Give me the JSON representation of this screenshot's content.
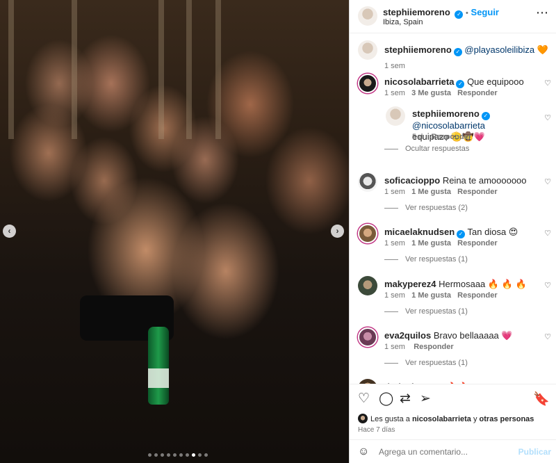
{
  "photo": {
    "description_icon": "party-photo",
    "prev_icon": "chevron-left-icon",
    "next_icon": "chevron-right-icon",
    "carousel_index": 8,
    "carousel_count": 10
  },
  "header": {
    "username": "stephiiemoreno",
    "separator": "•",
    "follow": "Seguir",
    "location": "Ibiza, Spain",
    "more": "⋯"
  },
  "caption": {
    "username": "stephiiemoreno",
    "mention": "@playasoleilibiza",
    "emoji": "🧡",
    "time": "1 sem"
  },
  "comments": [
    {
      "username": "nicosolabarrieta",
      "verified": true,
      "text": "Que equipooo",
      "time": "1 sem",
      "likes": "3 Me gusta",
      "reply": "Responder"
    },
    {
      "username": "stephiiemoreno",
      "verified": true,
      "mention": "@nicosolabarrieta",
      "text": "equipazo 🫡🤠💗",
      "time": "5 d",
      "reply": "Responder",
      "hide_replies": "Ocultar respuestas"
    },
    {
      "username": "soficacioppo",
      "text": "Reina te amooooooo",
      "time": "1 sem",
      "likes": "1 Me gusta",
      "reply": "Responder",
      "view_replies": "Ver respuestas (2)"
    },
    {
      "username": "micaelaknudsen",
      "verified": true,
      "text": "Tan diosa 😍",
      "time": "1 sem",
      "likes": "1 Me gusta",
      "reply": "Responder",
      "view_replies": "Ver respuestas (1)"
    },
    {
      "username": "makyperez4",
      "text": "Hermosaaa 🔥 🔥 🔥",
      "time": "1 sem",
      "likes": "1 Me gusta",
      "reply": "Responder",
      "view_replies": "Ver respuestas (1)"
    },
    {
      "username": "eva2quilos",
      "text": "Bravo bellaaaaa 💗",
      "time": "1 sem",
      "reply": "Responder",
      "view_replies": "Ver respuestas (1)"
    },
    {
      "username": "dario_loconte",
      "text": "🔥🔥"
    }
  ],
  "actions": {
    "like_icon": "heart-icon",
    "comment_icon": "comment-icon",
    "share_icon": "share-icon",
    "save_icon": "bookmark-icon",
    "likes_prefix": "Les gusta a",
    "likes_user": "nicosolabarrieta",
    "likes_mid": "y",
    "likes_others": "otras personas",
    "date": "Hace 7 días"
  },
  "comment_box": {
    "placeholder": "Agrega un comentario...",
    "post": "Publicar"
  },
  "colors": {
    "accent": "#0095f6",
    "text": "#262626",
    "muted": "#737373"
  }
}
